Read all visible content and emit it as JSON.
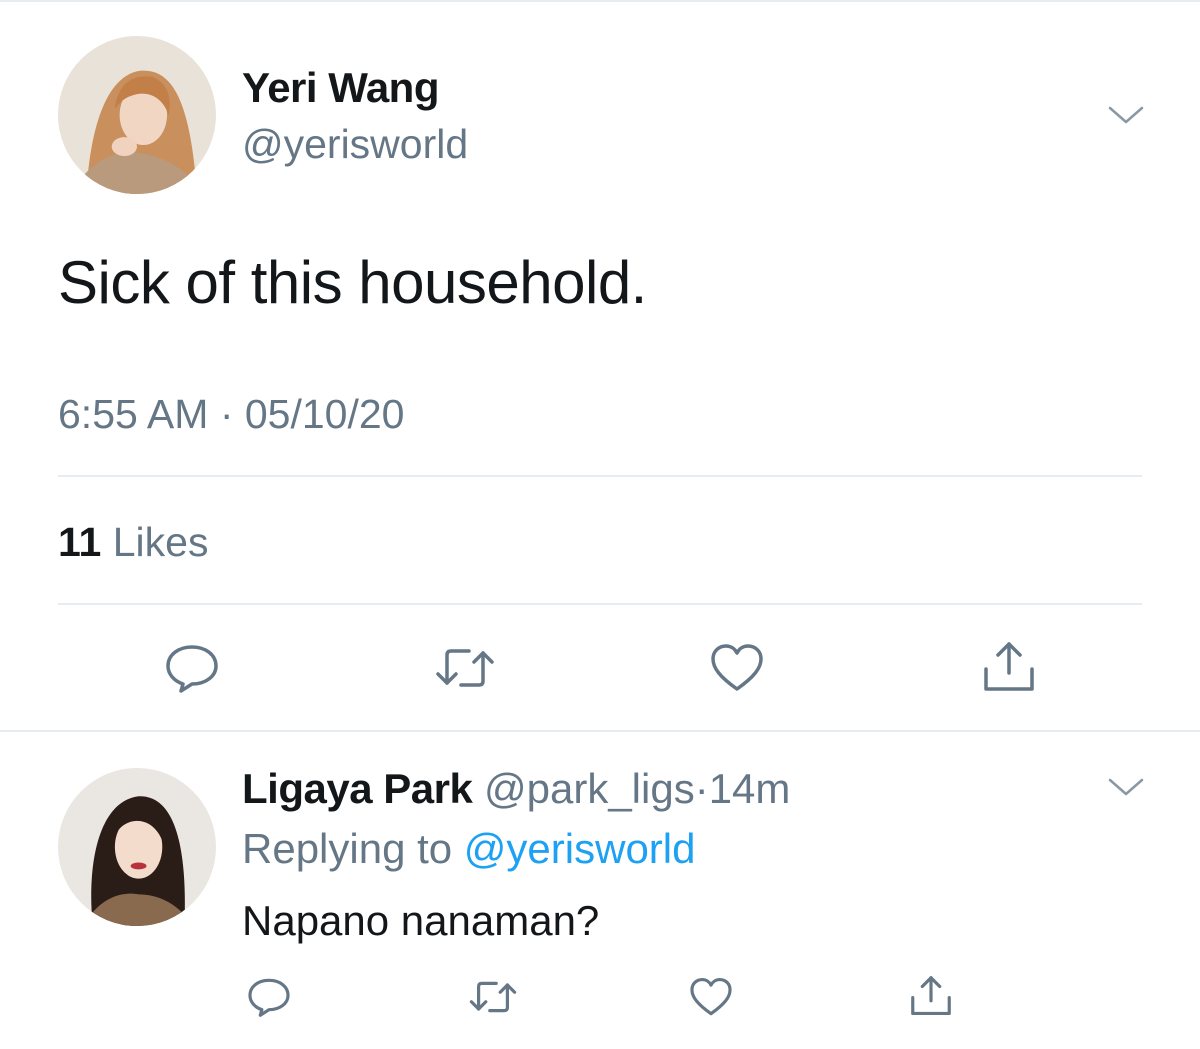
{
  "tweet": {
    "author_name": "Yeri Wang",
    "author_handle": "@yerisworld",
    "text": "Sick of this household.",
    "timestamp": "6:55 AM · 05/10/20",
    "likes_count": "11",
    "likes_label": "Likes"
  },
  "reply": {
    "author_name": "Ligaya Park",
    "author_handle": "@park_ligs",
    "separator": "·",
    "time": "14m",
    "replying_prefix": "Replying to",
    "replying_mention": "@yerisworld",
    "text": "Napano nanaman?"
  },
  "icons": {
    "reply": "speech-bubble-icon",
    "retweet": "retweet-icon",
    "like": "heart-icon",
    "share": "share-icon",
    "menu": "chevron-down-icon"
  },
  "colors": {
    "text_primary": "#14171a",
    "text_secondary": "#657786",
    "link": "#1da1f2",
    "divider": "#e6ecf0"
  }
}
